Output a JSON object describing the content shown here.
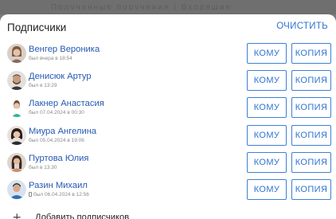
{
  "backdrop": {
    "text": "Полученные поручения | Входящие"
  },
  "dialog": {
    "title": "Подписчики",
    "clear_label": "ОЧИСТИТЬ",
    "add_label": "Добавить подписчиков",
    "button_to_label": "КОМУ",
    "button_copy_label": "КОПИЯ"
  },
  "subscribers": [
    {
      "name": "Венгер Вероника",
      "status": "был вчера в 18:54",
      "avatar": "woman-brown-hair-icon",
      "mobile": false
    },
    {
      "name": "Денисюк Артур",
      "status": "был в 13:29",
      "avatar": "man-beard-icon",
      "mobile": false
    },
    {
      "name": "Лакнер Анастасия",
      "status": "был 07.04.2024 в 00:30",
      "avatar": "woman-green-top-icon",
      "mobile": false
    },
    {
      "name": "Миура Ангелина",
      "status": "был 05.04.2024 в 19:06",
      "avatar": "woman-dark-hair-icon",
      "mobile": false
    },
    {
      "name": "Пуртова Юлия",
      "status": "был в 13:30",
      "avatar": "woman-long-hair-icon",
      "mobile": false
    },
    {
      "name": "Разин Михаил",
      "status": "был 06.04.2024 в 12:56",
      "avatar": "man-blue-shirt-icon",
      "mobile": true
    }
  ],
  "colors": {
    "accent": "#2f74d0",
    "name_link": "#2659b0",
    "overlay": "#7a7a7a"
  }
}
